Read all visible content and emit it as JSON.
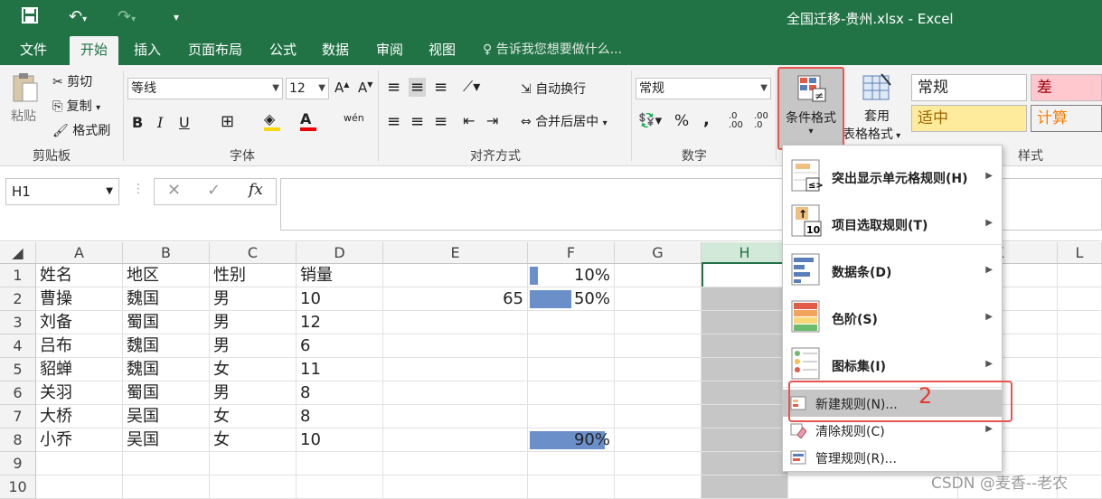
{
  "window": {
    "title": "全国迁移-贵州.xlsx - Excel"
  },
  "quick_access": {
    "save_icon": "save-icon",
    "undo_icon": "undo-icon",
    "redo_icon": "redo-icon",
    "customize_icon": "customize-icon"
  },
  "tabs": [
    {
      "label": "文件"
    },
    {
      "label": "开始"
    },
    {
      "label": "插入"
    },
    {
      "label": "页面布局"
    },
    {
      "label": "公式"
    },
    {
      "label": "数据"
    },
    {
      "label": "审阅"
    },
    {
      "label": "视图"
    }
  ],
  "tell_me": "告诉我您想要做什么...",
  "ribbon": {
    "clipboard": {
      "paste": "粘贴",
      "cut": "剪切",
      "copy": "复制",
      "format_painter": "格式刷",
      "group": "剪贴板"
    },
    "font": {
      "name": "等线",
      "size": "12",
      "bold": "B",
      "italic": "I",
      "underline": "U",
      "group": "字体"
    },
    "align": {
      "wrap": "自动换行",
      "merge": "合并后居中",
      "group": "对齐方式"
    },
    "number": {
      "format": "常规",
      "percent": "%",
      "comma": ",",
      "group": "数字"
    },
    "conditional_format": "条件格式",
    "table_format_1": "套用",
    "table_format_2": "表格格式",
    "styles": {
      "normal": "常规",
      "bad": "差",
      "neutral": "适中",
      "calc": "计算",
      "group": "样式"
    }
  },
  "formula_bar": {
    "name_box": "H1",
    "fx": "fx",
    "content": ""
  },
  "columns": [
    "A",
    "B",
    "C",
    "D",
    "E",
    "F",
    "G",
    "H",
    "K",
    "L"
  ],
  "rows": [
    "1",
    "2",
    "3",
    "4",
    "5",
    "6",
    "7",
    "8",
    "9",
    "10"
  ],
  "sheet": {
    "A": [
      "姓名",
      "曹操",
      "刘备",
      "吕布",
      "貂蝉",
      "关羽",
      "大桥",
      "小乔",
      "",
      ""
    ],
    "B": [
      "地区",
      "魏国",
      "蜀国",
      "魏国",
      "魏国",
      "蜀国",
      "吴国",
      "吴国",
      "",
      ""
    ],
    "C": [
      "性别",
      "男",
      "男",
      "男",
      "女",
      "男",
      "女",
      "女",
      "",
      ""
    ],
    "D": [
      "销量",
      "10",
      "12",
      "6",
      "11",
      "8",
      "8",
      "10",
      "",
      ""
    ],
    "E": [
      "",
      "65",
      "",
      "",
      "",
      "",
      "",
      "",
      "",
      ""
    ],
    "F": [
      "10%",
      "50%",
      "",
      "",
      "",
      "",
      "",
      "90%",
      "",
      ""
    ]
  },
  "databars": [
    0.1,
    0.5,
    0.9
  ],
  "menu": {
    "highlight": "突出显示单元格规则(H)",
    "top_bottom": "项目选取规则(T)",
    "data_bars": "数据条(D)",
    "color_scales": "色阶(S)",
    "icon_sets": "图标集(I)",
    "new_rule": "新建规则(N)...",
    "clear_rules": "清除规则(C)",
    "manage_rules": "管理规则(R)..."
  },
  "annotation": "2",
  "watermark": "CSDN @麦香--老农",
  "colors": {
    "excel_green": "#217346",
    "selection": "#c6c6c6",
    "databar": "#6b8fc8",
    "annotation_red": "#e8554e"
  }
}
